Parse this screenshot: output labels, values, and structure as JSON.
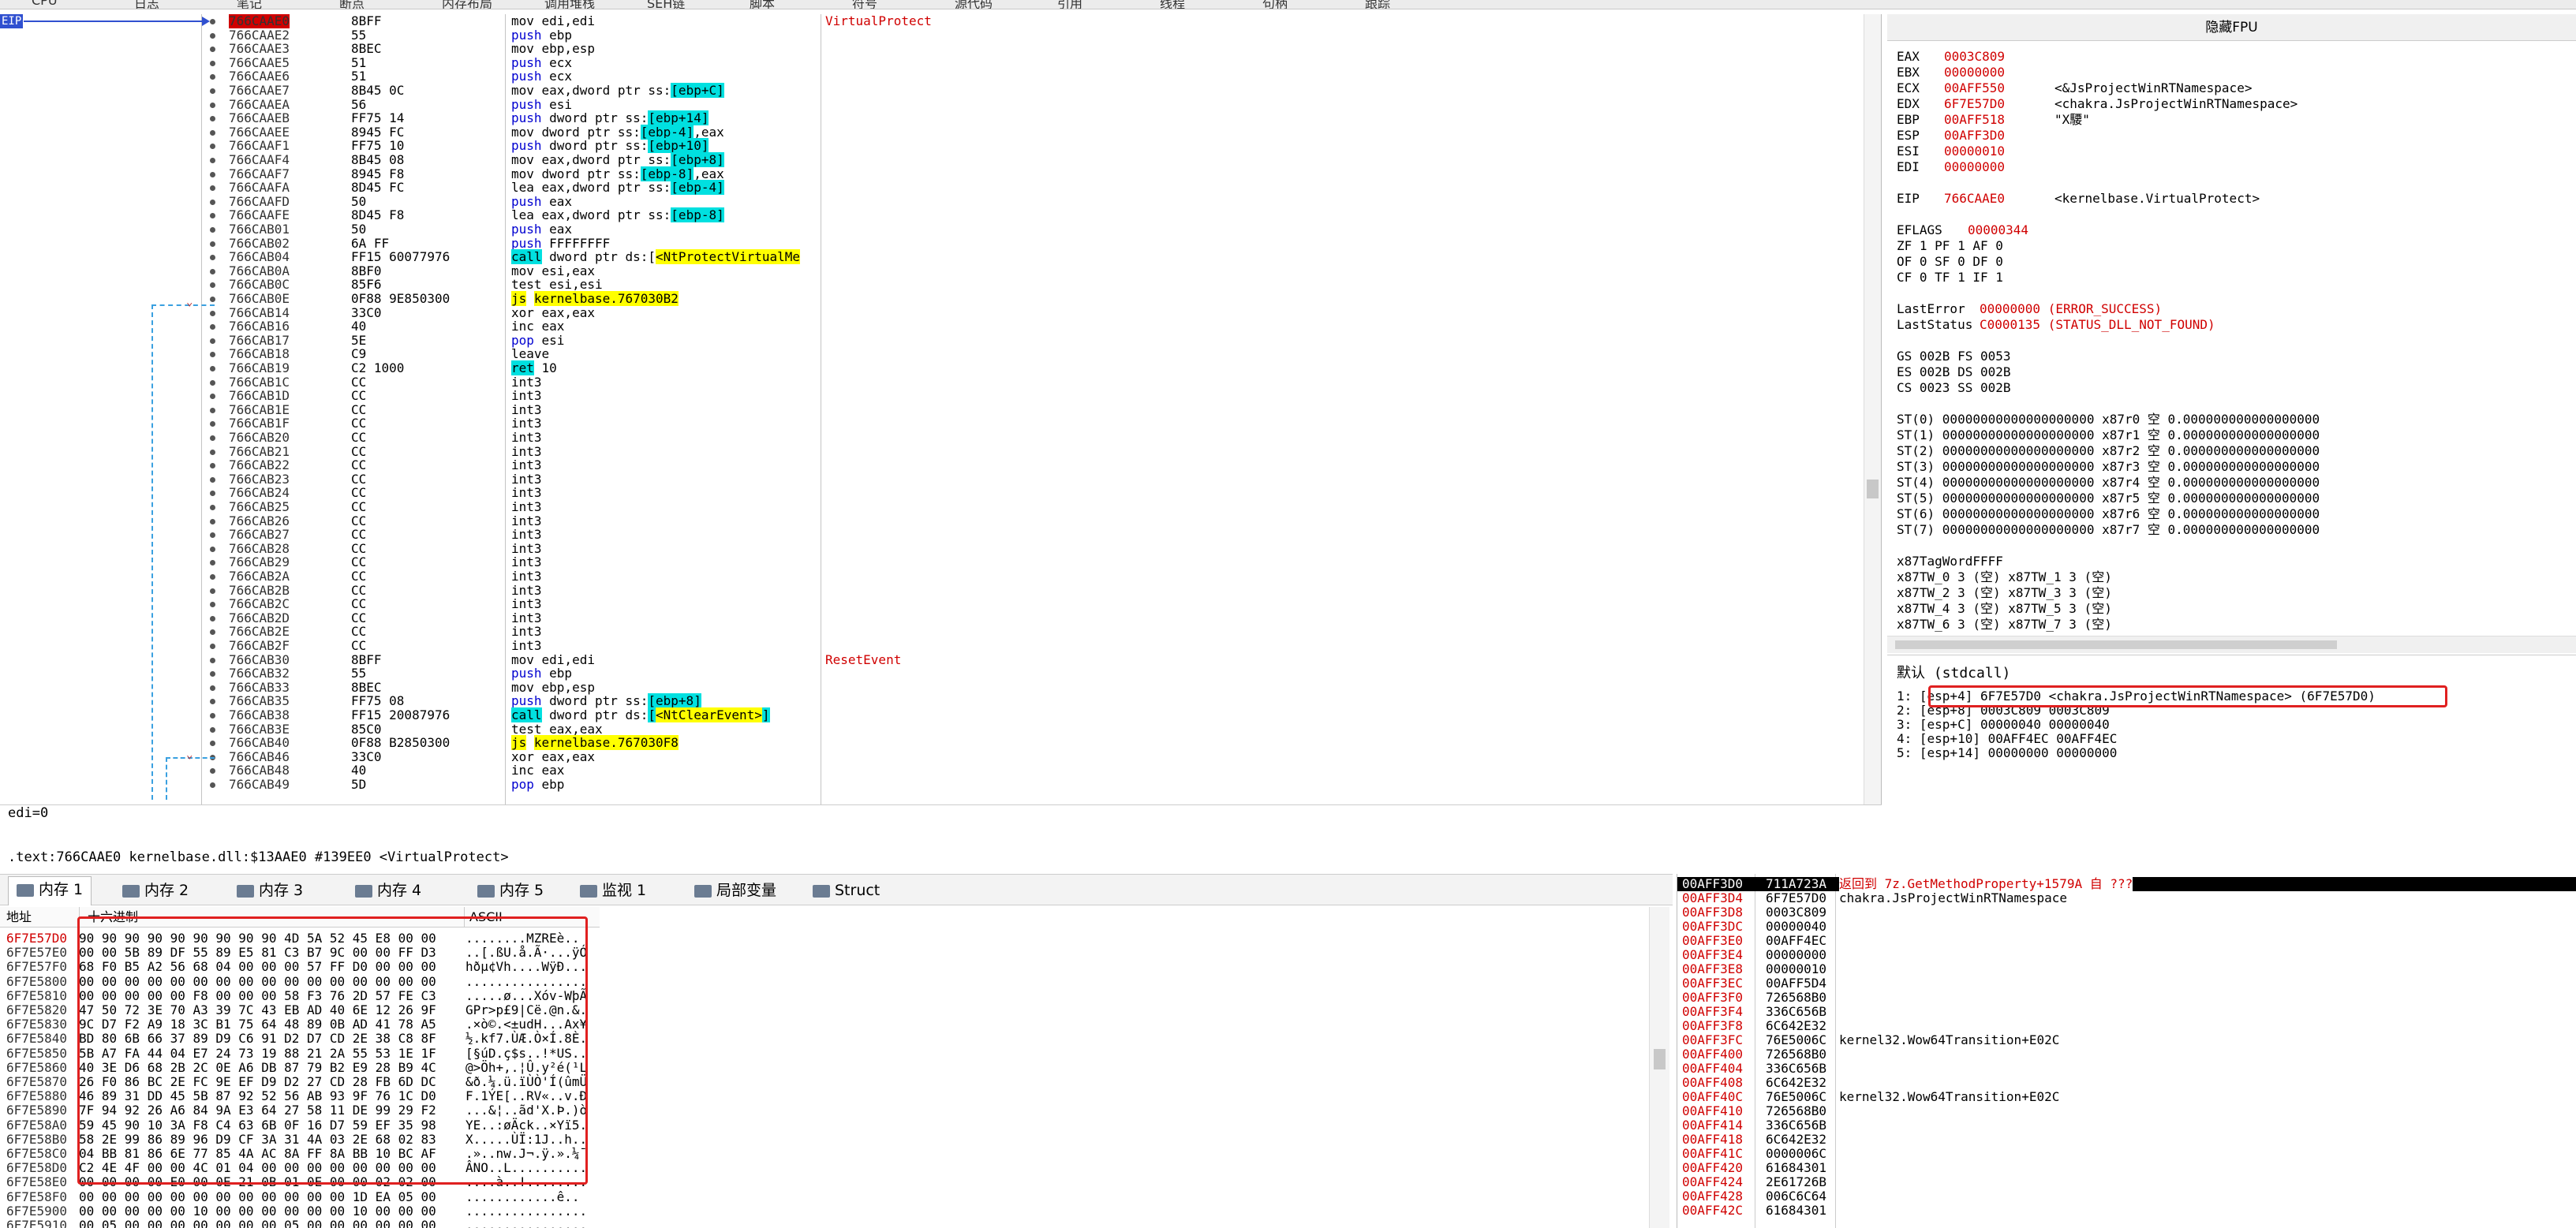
{
  "toolbar": [
    "CPU",
    "日志",
    "笔记",
    "断点",
    "内存布局",
    "调用堆栈",
    "SEH链",
    "脚本",
    "符号",
    "源代码",
    "引用",
    "线程",
    "句柄",
    "跟踪"
  ],
  "cpu": {
    "eip_label": "EIP",
    "rows": [
      {
        "addr": "766CAAE0",
        "bytes": "8BFF",
        "ins": "mov edi,edi",
        "cmt": "VirtualProtect",
        "eip": true
      },
      {
        "addr": "766CAAE2",
        "bytes": "55",
        "ins": "push ebp"
      },
      {
        "addr": "766CAAE3",
        "bytes": "8BEC",
        "ins": "mov ebp,esp"
      },
      {
        "addr": "766CAAE5",
        "bytes": "51",
        "ins": "push ecx"
      },
      {
        "addr": "766CAAE6",
        "bytes": "51",
        "ins": "push ecx"
      },
      {
        "addr": "766CAAE7",
        "bytes": "8B45 0C",
        "ins": "mov eax,dword ptr ss:[ebp+C]"
      },
      {
        "addr": "766CAAEA",
        "bytes": "56",
        "ins": "push esi"
      },
      {
        "addr": "766CAAEB",
        "bytes": "FF75 14",
        "ins": "push dword ptr ss:[ebp+14]"
      },
      {
        "addr": "766CAAEE",
        "bytes": "8945 FC",
        "ins": "mov dword ptr ss:[ebp-4],eax"
      },
      {
        "addr": "766CAAF1",
        "bytes": "FF75 10",
        "ins": "push dword ptr ss:[ebp+10]"
      },
      {
        "addr": "766CAAF4",
        "bytes": "8B45 08",
        "ins": "mov eax,dword ptr ss:[ebp+8]"
      },
      {
        "addr": "766CAAF7",
        "bytes": "8945 F8",
        "ins": "mov dword ptr ss:[ebp-8],eax"
      },
      {
        "addr": "766CAAFA",
        "bytes": "8D45 FC",
        "ins": "lea eax,dword ptr ss:[ebp-4]"
      },
      {
        "addr": "766CAAFD",
        "bytes": "50",
        "ins": "push eax"
      },
      {
        "addr": "766CAAFE",
        "bytes": "8D45 F8",
        "ins": "lea eax,dword ptr ss:[ebp-8]"
      },
      {
        "addr": "766CAB01",
        "bytes": "50",
        "ins": "push eax"
      },
      {
        "addr": "766CAB02",
        "bytes": "6A FF",
        "ins": "push FFFFFFFF"
      },
      {
        "addr": "766CAB04",
        "bytes": "FF15 60077976",
        "ins": "call dword ptr ds:[<NtProtectVirtualMe"
      },
      {
        "addr": "766CAB0A",
        "bytes": "8BF0",
        "ins": "mov esi,eax"
      },
      {
        "addr": "766CAB0C",
        "bytes": "85F6",
        "ins": "test esi,esi"
      },
      {
        "addr": "766CAB0E",
        "bytes": "0F88 9E850300",
        "ins": "js kernelbase.767030B2"
      },
      {
        "addr": "766CAB14",
        "bytes": "33C0",
        "ins": "xor eax,eax"
      },
      {
        "addr": "766CAB16",
        "bytes": "40",
        "ins": "inc eax"
      },
      {
        "addr": "766CAB17",
        "bytes": "5E",
        "ins": "pop esi"
      },
      {
        "addr": "766CAB18",
        "bytes": "C9",
        "ins": "leave"
      },
      {
        "addr": "766CAB19",
        "bytes": "C2 1000",
        "ins": "ret 10"
      },
      {
        "addr": "766CAB1C",
        "bytes": "CC",
        "ins": "int3"
      },
      {
        "addr": "766CAB1D",
        "bytes": "CC",
        "ins": "int3"
      },
      {
        "addr": "766CAB1E",
        "bytes": "CC",
        "ins": "int3"
      },
      {
        "addr": "766CAB1F",
        "bytes": "CC",
        "ins": "int3"
      },
      {
        "addr": "766CAB20",
        "bytes": "CC",
        "ins": "int3"
      },
      {
        "addr": "766CAB21",
        "bytes": "CC",
        "ins": "int3"
      },
      {
        "addr": "766CAB22",
        "bytes": "CC",
        "ins": "int3"
      },
      {
        "addr": "766CAB23",
        "bytes": "CC",
        "ins": "int3"
      },
      {
        "addr": "766CAB24",
        "bytes": "CC",
        "ins": "int3"
      },
      {
        "addr": "766CAB25",
        "bytes": "CC",
        "ins": "int3"
      },
      {
        "addr": "766CAB26",
        "bytes": "CC",
        "ins": "int3"
      },
      {
        "addr": "766CAB27",
        "bytes": "CC",
        "ins": "int3"
      },
      {
        "addr": "766CAB28",
        "bytes": "CC",
        "ins": "int3"
      },
      {
        "addr": "766CAB29",
        "bytes": "CC",
        "ins": "int3"
      },
      {
        "addr": "766CAB2A",
        "bytes": "CC",
        "ins": "int3"
      },
      {
        "addr": "766CAB2B",
        "bytes": "CC",
        "ins": "int3"
      },
      {
        "addr": "766CAB2C",
        "bytes": "CC",
        "ins": "int3"
      },
      {
        "addr": "766CAB2D",
        "bytes": "CC",
        "ins": "int3"
      },
      {
        "addr": "766CAB2E",
        "bytes": "CC",
        "ins": "int3"
      },
      {
        "addr": "766CAB2F",
        "bytes": "CC",
        "ins": "int3"
      },
      {
        "addr": "766CAB30",
        "bytes": "8BFF",
        "ins": "mov edi,edi",
        "cmt": "ResetEvent",
        "red": true
      },
      {
        "addr": "766CAB32",
        "bytes": "55",
        "ins": "push ebp"
      },
      {
        "addr": "766CAB33",
        "bytes": "8BEC",
        "ins": "mov ebp,esp"
      },
      {
        "addr": "766CAB35",
        "bytes": "FF75 08",
        "ins": "push dword ptr ss:[ebp+8]"
      },
      {
        "addr": "766CAB38",
        "bytes": "FF15 20087976",
        "ins": "call dword ptr ds:[<NtClearEvent>]"
      },
      {
        "addr": "766CAB3E",
        "bytes": "85C0",
        "ins": "test eax,eax"
      },
      {
        "addr": "766CAB40",
        "bytes": "0F88 B2850300",
        "ins": "js kernelbase.767030F8"
      },
      {
        "addr": "766CAB46",
        "bytes": "33C0",
        "ins": "xor eax,eax"
      },
      {
        "addr": "766CAB48",
        "bytes": "40",
        "ins": "inc eax"
      },
      {
        "addr": "766CAB49",
        "bytes": "5D",
        "ins": "pop ebp"
      }
    ]
  },
  "info": {
    "line1": "edi=0",
    "line2": ".text:766CAAE0 kernelbase.dll:$13AAE0 #139EE0 <VirtualProtect>"
  },
  "regs": {
    "title": "隐藏FPU",
    "gp": [
      {
        "n": "EAX",
        "v": "0003C809",
        "c": ""
      },
      {
        "n": "EBX",
        "v": "00000000",
        "c": ""
      },
      {
        "n": "ECX",
        "v": "00AFF550",
        "c": "<&JsProjectWinRTNamespace>"
      },
      {
        "n": "EDX",
        "v": "6F7E57D0",
        "c": "<chakra.JsProjectWinRTNamespace>"
      },
      {
        "n": "EBP",
        "v": "00AFF518",
        "c": "\"X騕\""
      },
      {
        "n": "ESP",
        "v": "00AFF3D0",
        "c": ""
      },
      {
        "n": "ESI",
        "v": "00000010",
        "c": ""
      },
      {
        "n": "EDI",
        "v": "00000000",
        "c": ""
      }
    ],
    "eip": {
      "n": "EIP",
      "v": "766CAAE0",
      "c": "<kernelbase.VirtualProtect>"
    },
    "eflags": {
      "n": "EFLAGS",
      "v": "00000344"
    },
    "flags": [
      "ZF 1  PF 1  AF 0",
      "OF 0  SF 0  DF 0",
      "CF 0  TF 1  IF 1"
    ],
    "lasterror": {
      "n": "LastError",
      "v": "00000000 (ERROR_SUCCESS)"
    },
    "laststatus": {
      "n": "LastStatus",
      "v": "C0000135 (STATUS_DLL_NOT_FOUND)"
    },
    "segs": [
      "GS 002B  FS 0053",
      "ES 002B  DS 002B",
      "CS 0023  SS 002B"
    ],
    "st": [
      "ST(0) 00000000000000000000 x87r0 空 0.000000000000000000",
      "ST(1) 00000000000000000000 x87r1 空 0.000000000000000000",
      "ST(2) 00000000000000000000 x87r2 空 0.000000000000000000",
      "ST(3) 00000000000000000000 x87r3 空 0.000000000000000000",
      "ST(4) 00000000000000000000 x87r4 空 0.000000000000000000",
      "ST(5) 00000000000000000000 x87r5 空 0.000000000000000000",
      "ST(6) 00000000000000000000 x87r6 空 0.000000000000000000",
      "ST(7) 00000000000000000000 x87r7 空 0.000000000000000000"
    ],
    "tagword": "x87TagWordFFFF",
    "tw": [
      "x87TW_0 3 (空)      x87TW_1 3 (空)",
      "x87TW_2 3 (空)      x87TW_3 3 (空)",
      "x87TW_4 3 (空)      x87TW_5 3 (空)",
      "x87TW_6 3 (空)      x87TW_7 3 (空)"
    ]
  },
  "callconv": {
    "label": "默认 (stdcall)",
    "args": [
      "1: [esp+4] 6F7E57D0 <chakra.JsProjectWinRTNamespace> (6F7E57D0)",
      "2: [esp+8] 0003C809 0003C809",
      "3: [esp+C] 00000040 00000040",
      "4: [esp+10] 00AFF4EC 00AFF4EC",
      "5: [esp+14] 00000000 00000000"
    ]
  },
  "tabs": [
    "内存 1",
    "内存 2",
    "内存 3",
    "内存 4",
    "内存 5",
    "监视 1",
    "局部变量",
    "Struct"
  ],
  "dump": {
    "headers": [
      "地址",
      "十六进制",
      "ASCII"
    ],
    "rows": [
      {
        "a": "6F7E57D0",
        "h": "90 90 90 90 90 90 90 90 90 4D 5A 52 45 E8 00 00",
        "s": "........MZREè.."
      },
      {
        "a": "6F7E57E0",
        "h": "00 00 5B 89 DF 55 89 E5 81 C3 B7 9C 00 00 FF D3",
        "s": "..[.ßU.å.Ã·...ÿÓ"
      },
      {
        "a": "6F7E57F0",
        "h": "68 F0 B5 A2 56 68 04 00 00 00 57 FF D0 00 00 00",
        "s": "hðµ¢Vh....WÿÐ..."
      },
      {
        "a": "6F7E5800",
        "h": "00 00 00 00 00 00 00 00 00 00 00 00 00 00 00 00",
        "s": "................"
      },
      {
        "a": "6F7E5810",
        "h": "00 00 00 00 00 F8 00 00 00 58 F3 76 2D 57 FE C3",
        "s": ".....ø...Xóv-WþÃ"
      },
      {
        "a": "6F7E5820",
        "h": "47 50 72 3E 70 A3 39 7C 43 EB AD 40 6E 12 26 9F",
        "s": "GPr>p£9|Cë.@n.&."
      },
      {
        "a": "6F7E5830",
        "h": "9C D7 F2 A9 18 3C B1 75 64 48 89 0B AD 41 78 A5",
        "s": ".×ò©.<±udH...Ax¥"
      },
      {
        "a": "6F7E5840",
        "h": "BD 80 6B 66 37 89 D9 C6 91 D2 D7 CD 2E 38 C8 8F",
        "s": "½.kf7.ÙÆ.Ò×Í.8È."
      },
      {
        "a": "6F7E5850",
        "h": "5B A7 FA 44 04 E7 24 73 19 88 21 2A 55 53 1E 1F",
        "s": "[§úD.ç$s..!*US.."
      },
      {
        "a": "6F7E5860",
        "h": "40 3E D6 68 2B 2C 0E A6 DB 87 79 B2 E9 28 B9 4C",
        "s": "@>Öh+,.¦Û.y²é(¹L"
      },
      {
        "a": "6F7E5870",
        "h": "26 F0 86 BC 2E FC 9E EF D9 D2 27 CD 28 FB 6D DC",
        "s": "&ð.¼.ü.ïÙÒ'Í(ûmÜ"
      },
      {
        "a": "6F7E5880",
        "h": "46 89 31 DD 45 5B 87 92 52 56 AB 93 9F 76 1C D0",
        "s": "F.1ÝE[..RV«..v.Ð"
      },
      {
        "a": "6F7E5890",
        "h": "7F 94 92 26 A6 84 9A E3 64 27 58 11 DE 99 29 F2",
        "s": "...&¦..ãd'X.Þ.)ò"
      },
      {
        "a": "6F7E58A0",
        "h": "59 45 90 10 3A F8 C4 63 6B 0F 16 D7 59 EF 35 98",
        "s": "YE..:øÄck..×Yï5."
      },
      {
        "a": "6F7E58B0",
        "h": "58 2E 99 86 89 96 D9 CF 3A 31 4A 03 2E 68 02 83",
        "s": "X.....ÙÏ:1J..h.."
      },
      {
        "a": "6F7E58C0",
        "h": "04 BB 81 86 6E 77 85 4A AC 8A FF 8A BB 10 BC AF",
        "s": ".»..nw.J¬.ÿ.».¼¯"
      },
      {
        "a": "6F7E58D0",
        "h": "C2 4E 4F 00 00 4C 01 04 00 00 00 00 00 00 00 00",
        "s": "ÂNO..L.........."
      },
      {
        "a": "6F7E58E0",
        "h": "00 00 00 00 E0 00 0E 21 0B 01 0E 00 00 02 02 00",
        "s": "....à..!........"
      },
      {
        "a": "6F7E58F0",
        "h": "00 00 00 00 00 00 00 00 00 00 00 00 1D EA 05 00",
        "s": "............ê.."
      },
      {
        "a": "6F7E5900",
        "h": "00 00 00 00 00 10 00 00 00 00 00 00 10 00 00 00",
        "s": "................"
      },
      {
        "a": "6F7E5910",
        "h": "00 05 00 00 00 00 00 00 00 05 00 00 00 00 00 00",
        "s": "................"
      }
    ]
  },
  "stack": {
    "head_comment": "返回到 7z.GetMethodProperty+1579A 自 ???",
    "rows": [
      {
        "a": "00AFF3D0",
        "v": "711A723A",
        "c": "返回到 7z.GetMethodProperty+1579A 自 ???",
        "cur": true
      },
      {
        "a": "00AFF3D4",
        "v": "6F7E57D0",
        "c": "chakra.JsProjectWinRTNamespace"
      },
      {
        "a": "00AFF3D8",
        "v": "0003C809",
        "c": ""
      },
      {
        "a": "00AFF3DC",
        "v": "00000040",
        "c": ""
      },
      {
        "a": "00AFF3E0",
        "v": "00AFF4EC",
        "c": ""
      },
      {
        "a": "00AFF3E4",
        "v": "00000000",
        "c": ""
      },
      {
        "a": "00AFF3E8",
        "v": "00000010",
        "c": ""
      },
      {
        "a": "00AFF3EC",
        "v": "00AFF5D4",
        "c": ""
      },
      {
        "a": "00AFF3F0",
        "v": "726568B0",
        "c": ""
      },
      {
        "a": "00AFF3F4",
        "v": "336C656B",
        "c": ""
      },
      {
        "a": "00AFF3F8",
        "v": "6C642E32",
        "c": ""
      },
      {
        "a": "00AFF3FC",
        "v": "76E5006C",
        "c": "kernel32.Wow64Transition+E02C"
      },
      {
        "a": "00AFF400",
        "v": "726568B0",
        "c": ""
      },
      {
        "a": "00AFF404",
        "v": "336C656B",
        "c": ""
      },
      {
        "a": "00AFF408",
        "v": "6C642E32",
        "c": ""
      },
      {
        "a": "00AFF40C",
        "v": "76E5006C",
        "c": "kernel32.Wow64Transition+E02C"
      },
      {
        "a": "00AFF410",
        "v": "726568B0",
        "c": ""
      },
      {
        "a": "00AFF414",
        "v": "336C656B",
        "c": ""
      },
      {
        "a": "00AFF418",
        "v": "6C642E32",
        "c": ""
      },
      {
        "a": "00AFF41C",
        "v": "0000006C",
        "c": ""
      },
      {
        "a": "00AFF420",
        "v": "61684301",
        "c": ""
      },
      {
        "a": "00AFF424",
        "v": "2E61726B",
        "c": ""
      },
      {
        "a": "00AFF428",
        "v": "006C6C64",
        "c": ""
      },
      {
        "a": "00AFF42C",
        "v": "61684301",
        "c": ""
      }
    ]
  },
  "colors": {
    "eip": "#d00000",
    "highlight": "#ffff00",
    "cyan": "#00e0e0",
    "redbox": "#e02020",
    "jumpline": "#3aa0e0"
  }
}
